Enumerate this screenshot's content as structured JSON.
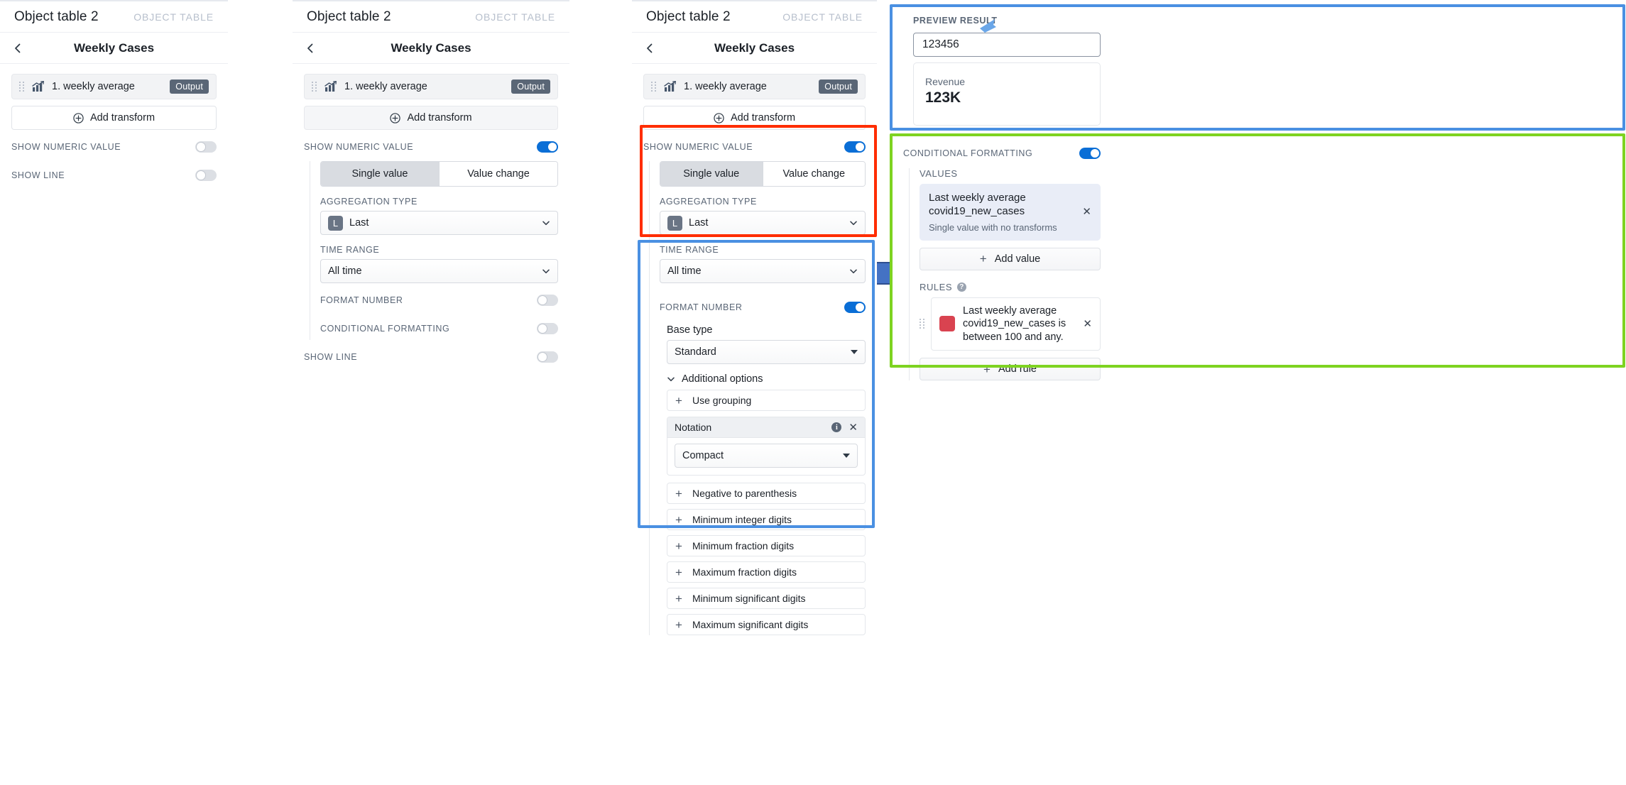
{
  "panels": {
    "p1": {
      "object_title": "Object table 2",
      "object_kind": "OBJECT TABLE",
      "sub_title": "Weekly Cases",
      "transform_label": "1. weekly average",
      "output_badge": "Output",
      "add_transform": "Add transform",
      "show_numeric_value": "SHOW NUMERIC VALUE",
      "show_line": "SHOW LINE"
    },
    "p2": {
      "object_title": "Object table 2",
      "object_kind": "OBJECT TABLE",
      "sub_title": "Weekly Cases",
      "transform_label": "1. weekly average",
      "output_badge": "Output",
      "add_transform": "Add transform",
      "show_numeric_value": "SHOW NUMERIC VALUE",
      "seg_single": "Single value",
      "seg_change": "Value change",
      "aggregation_label": "AGGREGATION TYPE",
      "aggregation_chip": "L",
      "aggregation_value": "Last",
      "time_range_label": "TIME RANGE",
      "time_range_value": "All time",
      "format_number": "FORMAT NUMBER",
      "conditional_formatting": "CONDITIONAL FORMATTING",
      "show_line": "SHOW LINE"
    },
    "p3": {
      "object_title": "Object table 2",
      "object_kind": "OBJECT TABLE",
      "sub_title": "Weekly Cases",
      "transform_label": "1. weekly average",
      "output_badge": "Output",
      "add_transform": "Add transform",
      "show_numeric_value": "SHOW NUMERIC VALUE",
      "seg_single": "Single value",
      "seg_change": "Value change",
      "aggregation_label": "AGGREGATION TYPE",
      "aggregation_chip": "L",
      "aggregation_value": "Last",
      "time_range_label": "TIME RANGE",
      "time_range_value": "All time",
      "format_number": "FORMAT NUMBER",
      "base_type_label": "Base type",
      "base_type_value": "Standard",
      "additional_options": "Additional options",
      "notation_title": "Notation",
      "notation_value": "Compact",
      "options": [
        "Use grouping",
        "Negative to parenthesis",
        "Minimum integer digits",
        "Minimum fraction digits",
        "Maximum fraction digits",
        "Minimum significant digits",
        "Maximum significant digits"
      ]
    },
    "p4": {
      "preview_label": "PREVIEW RESULT",
      "preview_input_value": "123456",
      "result_label": "Revenue",
      "result_value": "123K",
      "conditional_formatting": "CONDITIONAL FORMATTING",
      "values_label": "VALUES",
      "value_card_title": "Last weekly average covid19_new_cases",
      "value_card_sub": "Single value with no transforms",
      "add_value": "Add value",
      "rules_label": "RULES",
      "rule_text": "Last weekly average covid19_new_cases is between 100 and any.",
      "rule_color": "#d94350",
      "add_rule": "Add rule"
    }
  },
  "colors": {
    "accent_blue": "#0a6ed6",
    "highlight_red": "#ff2d00",
    "highlight_blue": "#4a90e2",
    "highlight_green": "#7ed321",
    "arrow_blue": "#4472c4"
  }
}
